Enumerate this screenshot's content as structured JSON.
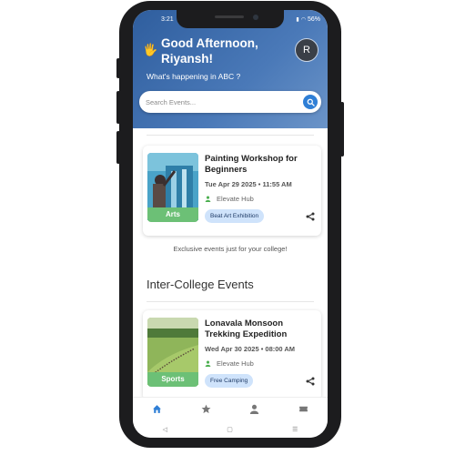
{
  "status_bar": {
    "time": "3:21",
    "battery": "56%"
  },
  "header": {
    "wave_emoji": "🖐",
    "greeting": "Good Afternoon, Riyansh!",
    "subtitle": "What's happening in ABC ?",
    "avatar_letter": "R",
    "gradient": [
      "#2f5e9e",
      "#6b94c8"
    ]
  },
  "search": {
    "placeholder": "Search Events...",
    "value": ""
  },
  "events": [
    {
      "title": "Painting Workshop for Beginners",
      "datetime": "Tue Apr 29 2025 • 11:55 AM",
      "host": "Elevate Hub",
      "category": "Arts",
      "chip": "Beat Art Exhibition"
    }
  ],
  "exclusive_note": "Exclusive events just for your college!",
  "inter_college": {
    "section_title": "Inter-College Events",
    "events": [
      {
        "title": "Lonavala Monsoon Trekking Expedition",
        "datetime": "Wed Apr 30 2025 • 08:00 AM",
        "host": "Elevate Hub",
        "category": "Sports",
        "chip": "Free Camping"
      }
    ]
  },
  "bottom_nav": [
    "home-icon",
    "star-icon",
    "person-icon",
    "ticket-icon"
  ],
  "system_nav": [
    "back-icon",
    "home-circle-icon",
    "recents-icon"
  ],
  "colors": {
    "accent": "#2f7fd6",
    "tag_green": "#6cc076",
    "chip_bg": "#cfe3fb"
  }
}
